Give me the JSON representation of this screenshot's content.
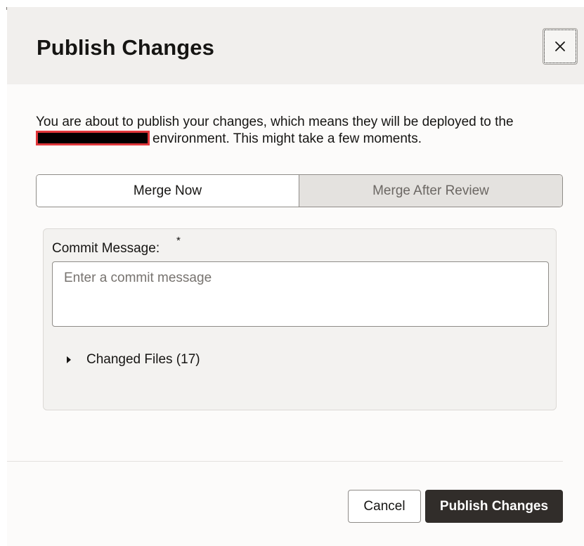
{
  "dialog": {
    "title": "Publish Changes",
    "close_icon": "close-icon",
    "intro_prefix": "You are about to publish your changes, which means they will be deployed to the",
    "intro_suffix": "environment. This might take a few moments."
  },
  "merge_mode": {
    "options": [
      {
        "label": "Merge Now",
        "selected": true
      },
      {
        "label": "Merge After Review",
        "selected": false
      }
    ]
  },
  "commit": {
    "label": "Commit Message:",
    "required_mark": "*",
    "value": "",
    "placeholder": "Enter a commit message"
  },
  "changed_files": {
    "label": "Changed Files (17)",
    "expanded": false,
    "icon": "caret-right-icon"
  },
  "footer": {
    "cancel_label": "Cancel",
    "publish_label": "Publish Changes"
  },
  "colors": {
    "header_bg": "#f1efed",
    "primary_button": "#312d2a",
    "redaction_border": "#e0373b"
  }
}
